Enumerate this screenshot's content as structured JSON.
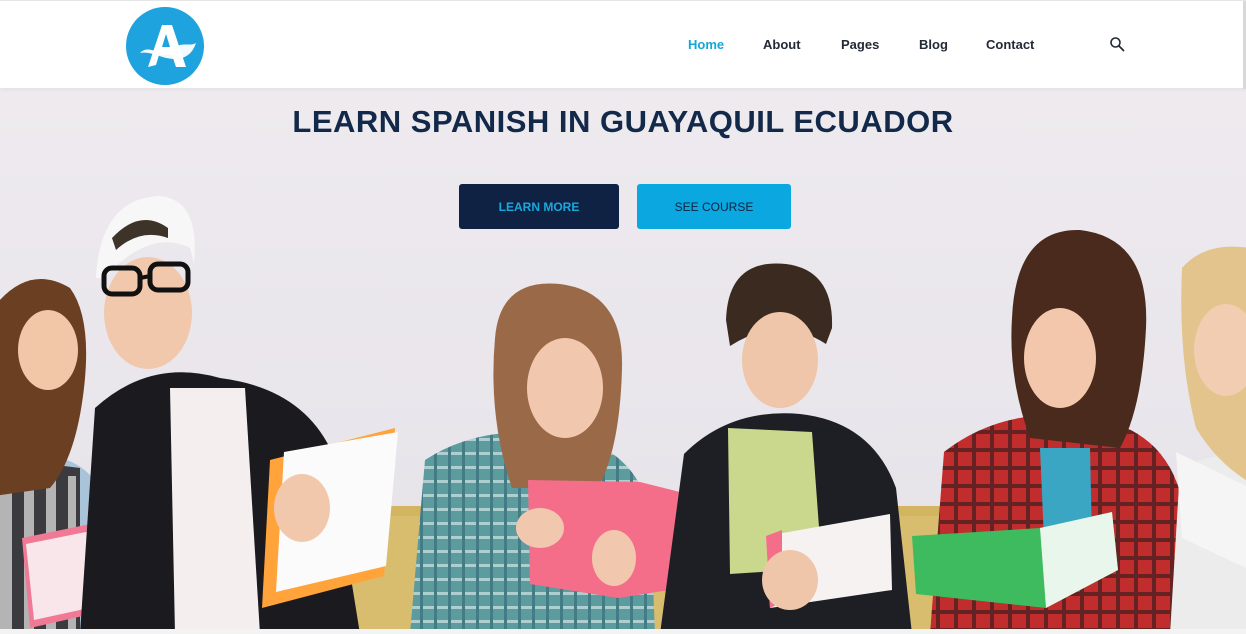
{
  "header": {
    "logo_letter": "A",
    "nav": {
      "home": "Home",
      "about": "About",
      "pages": "Pages",
      "blog": "Blog",
      "contact": "Contact"
    },
    "search_icon": "search-icon"
  },
  "hero": {
    "title": "LEARN SPANISH IN GUAYAQUIL ECUADOR",
    "learn_more": "LEARN MORE",
    "see_course": "SEE COURSE",
    "photo": "group of students reading notebooks"
  },
  "colors": {
    "accent": "#15a6d8",
    "navy": "#0f2244",
    "cyan_button": "#0aa7e1",
    "title": "#13294a"
  }
}
